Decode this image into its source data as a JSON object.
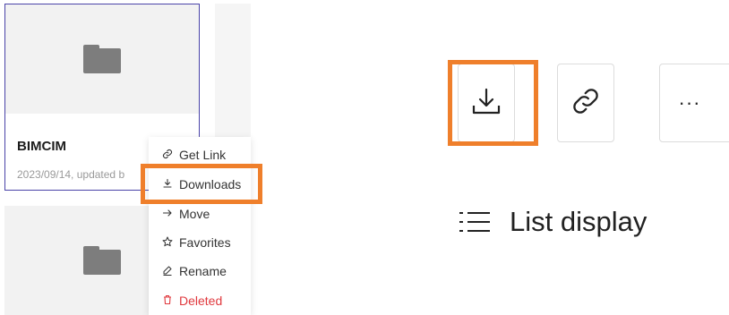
{
  "cards": [
    {
      "title": "BIMCIM",
      "meta": "2023/09/14, updated b"
    },
    {
      "title": "",
      "meta": ""
    }
  ],
  "context_menu": {
    "items": [
      {
        "label": "Get Link",
        "icon": "link-icon"
      },
      {
        "label": "Downloads",
        "icon": "download-icon"
      },
      {
        "label": "Move",
        "icon": "arrow-right-icon"
      },
      {
        "label": "Favorites",
        "icon": "star-icon"
      },
      {
        "label": "Rename",
        "icon": "pencil-icon"
      },
      {
        "label": "Deleted",
        "icon": "trash-icon"
      }
    ]
  },
  "toolbar": {
    "buttons": [
      {
        "name": "download",
        "icon": "download-icon"
      },
      {
        "name": "link",
        "icon": "link-icon"
      },
      {
        "name": "more",
        "icon": "more-icon",
        "label": "···"
      }
    ],
    "list_display_label": "List display"
  },
  "colors": {
    "highlight": "#ef7f2b",
    "selected_border": "#4a43a8",
    "danger": "#e0393e"
  }
}
